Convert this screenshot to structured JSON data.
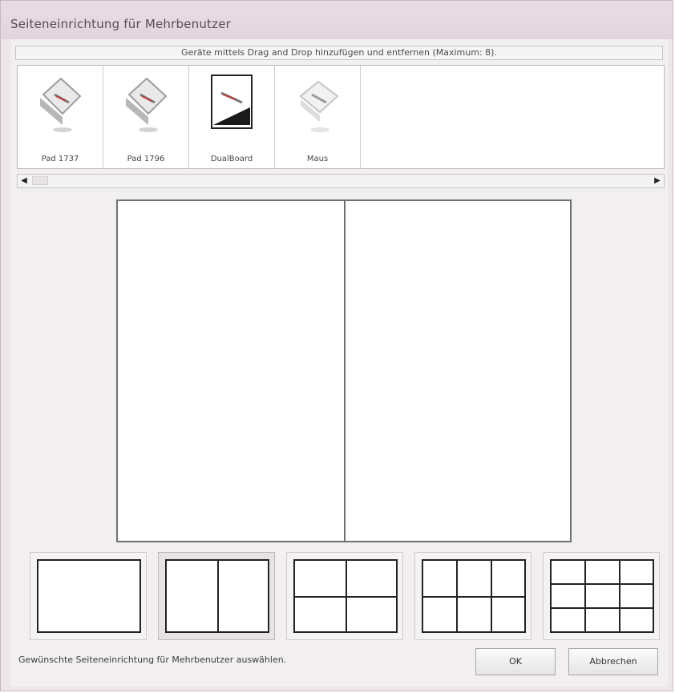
{
  "window": {
    "title": "Seiteneinrichtung für Mehrbenutzer"
  },
  "header": {
    "instruction": "Geräte mittels Drag and Drop hinzufügen und entfernen (Maximum: 8)."
  },
  "devices": [
    {
      "label": "Pad 1737",
      "icon": "tablet-icon"
    },
    {
      "label": "Pad 1796",
      "icon": "tablet-icon"
    },
    {
      "label": "DualBoard",
      "icon": "board-icon"
    },
    {
      "label": "Maus",
      "icon": "mouse-icon"
    }
  ],
  "scrollbar": {
    "left_arrow": "◀",
    "right_arrow": "▶"
  },
  "layouts": {
    "selected_index": 1,
    "options": [
      "1 Fenster",
      "2 Fenster",
      "4 Fenster",
      "6 Fenster",
      "9 Fenster"
    ]
  },
  "footer": {
    "status_text": "Gewünschte Seiteneinrichtung für Mehrbenutzer auswählen.",
    "ok_label": "OK",
    "cancel_label": "Abbrechen"
  },
  "colors": {
    "titlebar": "#e6d8e0",
    "frame": "#c9b7c3",
    "canvas_border": "#6f6f6f"
  }
}
